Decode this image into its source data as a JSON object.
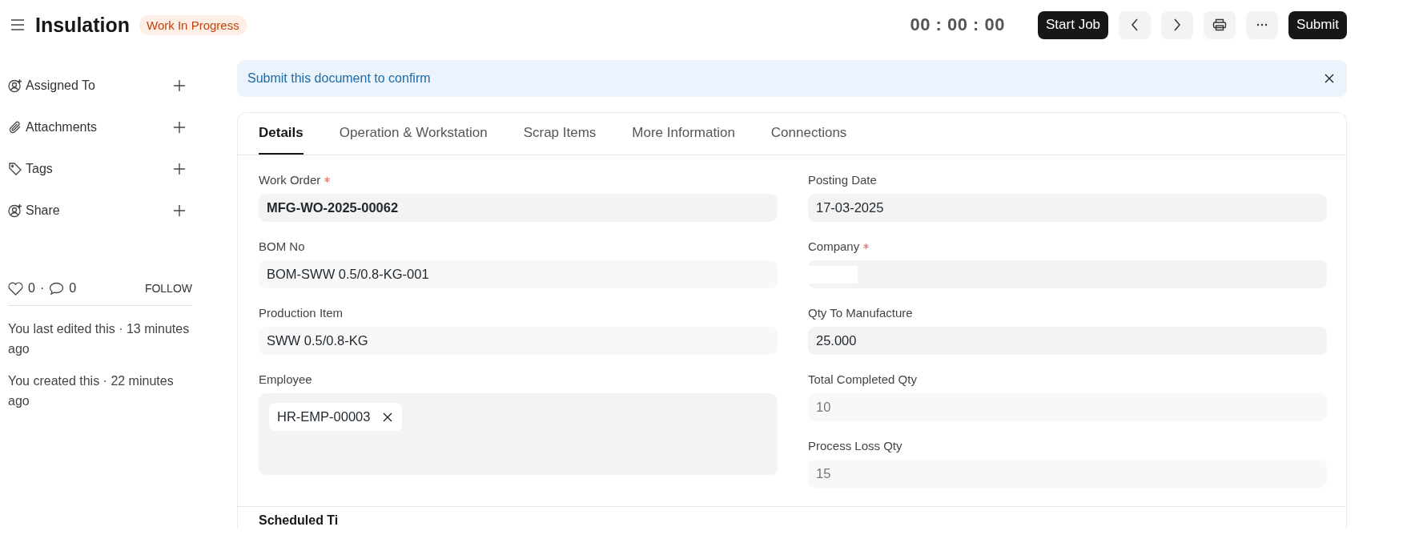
{
  "header": {
    "title": "Insulation",
    "status": "Work In Progress",
    "timer": "00 : 00 : 00",
    "primary_action": "Start Job",
    "submit": "Submit"
  },
  "sidebar": {
    "items": [
      {
        "label": "Assigned To",
        "kind": "assign"
      },
      {
        "label": "Attachments",
        "kind": "attach"
      },
      {
        "label": "Tags",
        "kind": "tag"
      },
      {
        "label": "Share",
        "kind": "share"
      }
    ],
    "likes": "0",
    "separator": "·",
    "comments": "0",
    "follow": "FOLLOW",
    "activity": [
      "You last edited this · 13 minutes ago",
      "You created this · 22 minutes ago"
    ]
  },
  "alert": {
    "message": "Submit this document to confirm"
  },
  "tabs": [
    {
      "label": "Details",
      "selected": true
    },
    {
      "label": "Operation & Workstation",
      "selected": false
    },
    {
      "label": "Scrap Items",
      "selected": false
    },
    {
      "label": "More Information",
      "selected": false
    },
    {
      "label": "Connections",
      "selected": false
    }
  ],
  "columns": [
    [
      {
        "label": "Work Order",
        "required": true,
        "kind": "link",
        "value": "MFG-WO-2025-00062"
      },
      {
        "label": "BOM No",
        "required": false,
        "kind": "readonly",
        "value": "BOM-SWW 0.5/0.8-KG-001"
      },
      {
        "label": "Production Item",
        "required": false,
        "kind": "readonly",
        "value": "SWW 0.5/0.8-KG"
      },
      {
        "label": "Employee",
        "required": false,
        "kind": "multiselect",
        "chips": [
          "HR-EMP-00003"
        ]
      }
    ],
    [
      {
        "label": "Posting Date",
        "required": false,
        "kind": "input",
        "value": "17-03-2025"
      },
      {
        "label": "Company",
        "required": true,
        "kind": "redacted"
      },
      {
        "label": "Qty To Manufacture",
        "required": false,
        "kind": "input",
        "value": "25.000"
      },
      {
        "label": "Total Completed Qty",
        "required": false,
        "kind": "disabled",
        "value": "10"
      },
      {
        "label": "Process Loss Qty",
        "required": false,
        "kind": "disabled",
        "value": "15"
      }
    ]
  ],
  "next_section": {
    "title": "Scheduled Ti"
  }
}
